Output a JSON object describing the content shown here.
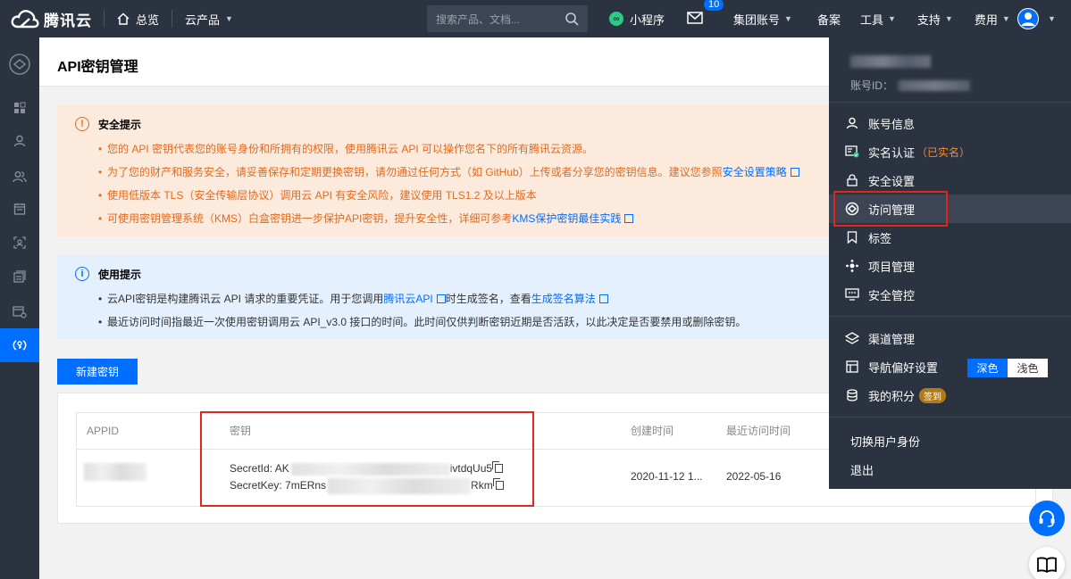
{
  "topbar": {
    "brand": "腾讯云",
    "overview": "总览",
    "products": "云产品",
    "search_placeholder": "搜索产品、文档...",
    "miniprogram": "小程序",
    "mail_badge": "10",
    "group_account": "集团账号",
    "icp": "备案",
    "tools": "工具",
    "support": "支持",
    "billing": "费用"
  },
  "page": {
    "title": "API密钥管理"
  },
  "security_alert": {
    "title": "安全提示",
    "line1": "您的 API 密钥代表您的账号身份和所拥有的权限，使用腾讯云 API 可以操作您名下的所有腾讯云资源。",
    "line2_pre": "为了您的财产和服务安全，请妥善保存和定期更换密钥，请勿通过任何方式（如 GitHub）上传或者分享您的密钥信息。建议您参照",
    "line2_link": "安全设置策略",
    "line3": "使用低版本 TLS（安全传输层协议）调用云 API 有安全风险，建议使用 TLS1.2 及以上版本",
    "line4_pre": "可使用密钥管理系统（KMS）白盒密钥进一步保护API密钥，提升安全性，详细可参考",
    "line4_link": "KMS保护密钥最佳实践"
  },
  "usage_alert": {
    "title": "使用提示",
    "line1_pre": "云API密钥是构建腾讯云 API 请求的重要凭证。用于您调用",
    "line1_link1": "腾讯云API",
    "line1_mid": "时生成签名，查看",
    "line1_link2": "生成签名算法",
    "line2": "最近访问时间指最近一次使用密钥调用云 API_v3.0 接口的时间。此时间仅供判断密钥近期是否活跃，以此决定是否要禁用或删除密钥。"
  },
  "create_button": "新建密钥",
  "table": {
    "headers": [
      "APPID",
      "密钥",
      "创建时间",
      "最近访问时间"
    ],
    "row": {
      "secret_id_label": "SecretId: AK",
      "secret_id_tail": "ivtdqUu5",
      "secret_key_label": "SecretKey: 7mERns",
      "secret_key_tail": "Rkm",
      "created": "2020-11-12 1...",
      "last_access": "2022-05-16"
    }
  },
  "panel": {
    "account_id_label": "账号ID：",
    "items": {
      "account_info": "账号信息",
      "real_name": "实名认证",
      "real_name_status": "（已实名）",
      "security_settings": "安全设置",
      "access_management": "访问管理",
      "tags": "标签",
      "project_management": "项目管理",
      "security_control": "安全管控",
      "channel_management": "渠道管理",
      "nav_preference": "导航偏好设置",
      "theme_dark": "深色",
      "theme_light": "浅色",
      "my_points": "我的积分",
      "sign_in": "签到",
      "switch_identity": "切换用户身份",
      "logout": "退出"
    }
  },
  "colors": {
    "topbar": "#2b3240",
    "primary": "#006eff",
    "warn_bg": "#fcebdd",
    "warn_text": "#e36a1f",
    "info_bg": "#e5f0ff",
    "highlight": "#e0261d"
  }
}
